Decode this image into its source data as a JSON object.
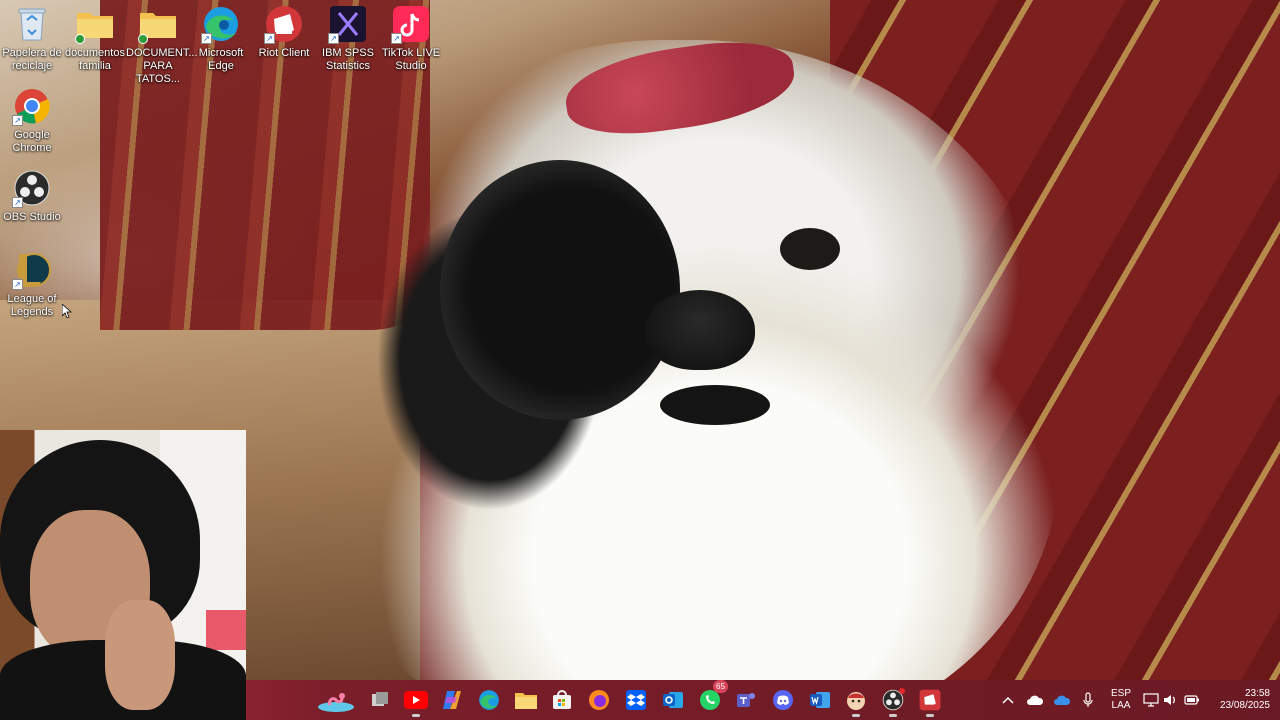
{
  "desktop": {
    "icons": [
      {
        "label": "Papelera de reciclaje",
        "icon": "recycle-bin-icon"
      },
      {
        "label": "documentos familia",
        "icon": "folder-icon"
      },
      {
        "label": "DOCUMENT... PARA TATOS...",
        "icon": "folder-icon"
      },
      {
        "label": "Microsoft Edge",
        "icon": "edge-icon"
      },
      {
        "label": "Riot Client",
        "icon": "riot-client-icon"
      },
      {
        "label": "IBM SPSS Statistics",
        "icon": "spss-icon"
      },
      {
        "label": "TikTok LIVE Studio",
        "icon": "tiktok-live-icon"
      },
      {
        "label": "Google Chrome",
        "icon": "chrome-icon"
      },
      {
        "label": "OBS Studio",
        "icon": "obs-icon"
      },
      {
        "label": "League of Legends",
        "icon": "league-of-legends-icon"
      }
    ]
  },
  "taskbar": {
    "apps": [
      {
        "name": "Widgets",
        "icon": "widgets-flamingo-icon"
      },
      {
        "name": "Task View",
        "icon": "task-view-icon"
      },
      {
        "name": "YouTube",
        "icon": "youtube-icon"
      },
      {
        "name": "Copilot",
        "icon": "copilot-icon"
      },
      {
        "name": "Microsoft Edge",
        "icon": "edge-icon"
      },
      {
        "name": "File Explorer",
        "icon": "file-explorer-icon"
      },
      {
        "name": "Microsoft Store",
        "icon": "store-icon"
      },
      {
        "name": "Firefox",
        "icon": "firefox-icon"
      },
      {
        "name": "Dropbox",
        "icon": "dropbox-icon"
      },
      {
        "name": "Outlook",
        "icon": "outlook-icon"
      },
      {
        "name": "WhatsApp",
        "icon": "whatsapp-icon",
        "badge": "65"
      },
      {
        "name": "Teams",
        "icon": "teams-icon"
      },
      {
        "name": "Discord",
        "icon": "discord-icon"
      },
      {
        "name": "Word",
        "icon": "word-icon"
      },
      {
        "name": "Unknown app",
        "icon": "cartoon-app-icon"
      },
      {
        "name": "OBS Studio",
        "icon": "obs-icon"
      },
      {
        "name": "Riot Client",
        "icon": "riot-client-icon"
      }
    ],
    "tray": {
      "language_line1": "ESP",
      "language_line2": "LAA",
      "time": "23:58",
      "date": "23/08/2025"
    }
  },
  "colors": {
    "taskbar": "#7a1e2a",
    "badge": "#d8445a"
  }
}
